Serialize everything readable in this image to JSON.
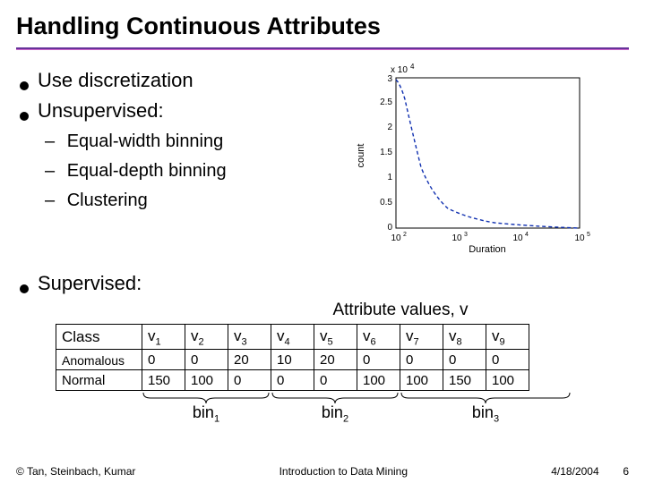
{
  "title": "Handling Continuous Attributes",
  "bullets_l1": [
    "Use discretization",
    "Unsupervised:"
  ],
  "bullets_l2": [
    "Equal-width binning",
    "Equal-depth binning",
    "Clustering"
  ],
  "bullet_supervised": "Supervised:",
  "attr_caption": "Attribute values, v",
  "table": {
    "header": [
      "Class",
      "v",
      "v",
      "v",
      "v",
      "v",
      "v",
      "v",
      "v",
      "v"
    ],
    "header_sub": [
      "",
      "1",
      "2",
      "3",
      "4",
      "5",
      "6",
      "7",
      "8",
      "9"
    ],
    "rows": [
      {
        "label": "Anomalous",
        "cells": [
          "0",
          "0",
          "20",
          "10",
          "20",
          "0",
          "0",
          "0",
          "0"
        ]
      },
      {
        "label": "Normal",
        "cells": [
          "150",
          "100",
          "0",
          "0",
          "0",
          "100",
          "100",
          "150",
          "100"
        ]
      }
    ]
  },
  "bins": [
    {
      "label": "bin",
      "sub": "1"
    },
    {
      "label": "bin",
      "sub": "2"
    },
    {
      "label": "bin",
      "sub": "3"
    }
  ],
  "footer": {
    "left": "© Tan, Steinbach, Kumar",
    "center": "Introduction to Data Mining",
    "right_date": "4/18/2004",
    "page": "6"
  },
  "chart_data": {
    "type": "line",
    "title": "",
    "xlabel": "Duration",
    "ylabel": "count",
    "x_scale": "log",
    "xlim": [
      100,
      100000
    ],
    "ylim": [
      0,
      3
    ],
    "y_multiplier_text": "x 10^4",
    "x_ticks": [
      "10^2",
      "10^3",
      "10^4",
      "10^5"
    ],
    "y_ticks": [
      0,
      0.5,
      1,
      1.5,
      2,
      2.5,
      3
    ],
    "series": [
      {
        "name": "count",
        "x": [
          100,
          150,
          250,
          500,
          1000,
          3000,
          10000,
          30000,
          100000
        ],
        "y": [
          3.0,
          2.2,
          1.2,
          0.55,
          0.28,
          0.12,
          0.05,
          0.02,
          0.0
        ]
      }
    ]
  }
}
